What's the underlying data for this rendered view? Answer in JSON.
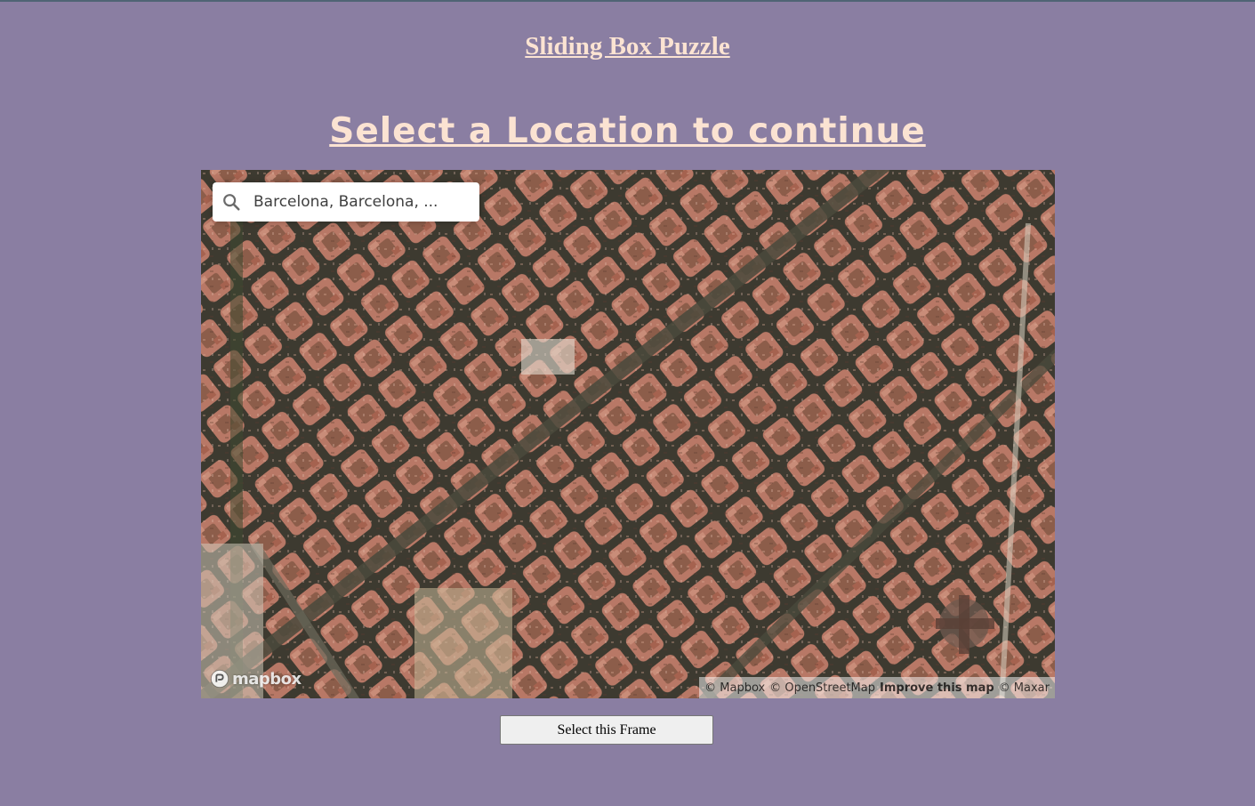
{
  "header": {
    "site_title": "Sliding Box Puzzle",
    "subtitle": "Select a Location to continue"
  },
  "map": {
    "search": {
      "value": "Barcelona, Barcelona, ...",
      "placeholder": "Search",
      "icon": "search-icon"
    },
    "logo_text": "mapbox",
    "attribution": {
      "mapbox": "© Mapbox",
      "osm": "© OpenStreetMap",
      "improve": "Improve this map",
      "maxar": "© Maxar"
    },
    "colors": {
      "roof": "#b87866",
      "street": "#3d3a30",
      "courtyard": "#8c5d4a"
    }
  },
  "actions": {
    "select_frame_label": "Select this Frame"
  },
  "colors": {
    "page_background": "#8a7ea2",
    "title_color": "#fbe3d2"
  }
}
